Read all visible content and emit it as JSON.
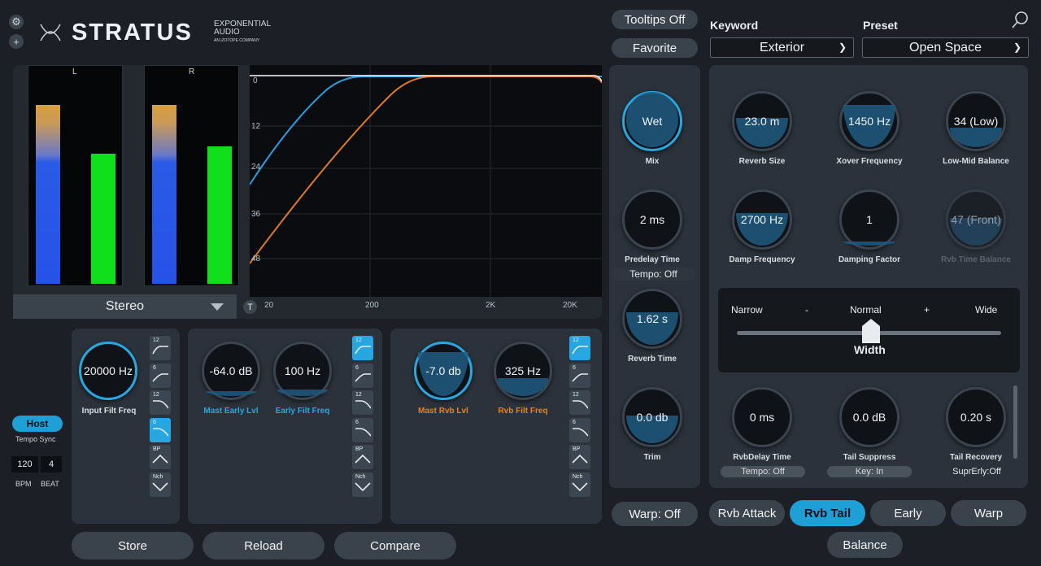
{
  "header": {
    "brand": "STRATUS",
    "maker_line1": "EXPONENTIAL",
    "maker_line2": "AUDIO",
    "maker_line3": "AN iZOTOPE COMPANY",
    "tooltips": "Tooltips Off",
    "favorite": "Favorite",
    "keyword_label": "Keyword",
    "keyword_value": "Exterior",
    "preset_label": "Preset",
    "preset_value": "Open Space"
  },
  "meters": {
    "left_label": "L",
    "right_label": "R",
    "mode": "Stereo"
  },
  "graph": {
    "y_ticks": [
      "0",
      "12",
      "24",
      "36",
      "48"
    ],
    "x_ticks": [
      "20",
      "200",
      "2K",
      "20K"
    ],
    "t_button": "T"
  },
  "filters": {
    "input_filt": {
      "value": "20000 Hz",
      "label": "Input Filt Freq"
    },
    "mast_early": {
      "value": "-64.0 dB",
      "label": "Mast Early Lvl"
    },
    "early_filt": {
      "value": "100 Hz",
      "label": "Early Filt Freq"
    },
    "mast_rvb": {
      "value": "-7.0 db",
      "label": "Mast Rvb Lvl"
    },
    "rvb_filt": {
      "value": "325 Hz",
      "label": "Rvb Filt Freq"
    },
    "types": [
      "12",
      "6",
      "12",
      "6",
      "BP",
      "Nch"
    ]
  },
  "tempo": {
    "host": "Host",
    "sync_label": "Tempo Sync",
    "bpm_value": "120",
    "beat_value": "4",
    "bpm_label": "BPM",
    "beat_label": "BEAT"
  },
  "bottom_buttons": {
    "store": "Store",
    "reload": "Reload",
    "compare": "Compare"
  },
  "center": {
    "mix": {
      "value": "Wet",
      "label": "Mix"
    },
    "predelay": {
      "value": "2 ms",
      "label": "Predelay Time"
    },
    "predelay_tempo": "Tempo: Off",
    "reverb_time": {
      "value": "1.62 s",
      "label": "Reverb Time"
    },
    "trim": {
      "value": "0.0 db",
      "label": "Trim"
    },
    "warp": "Warp: Off"
  },
  "right": {
    "reverb_size": {
      "value": "23.0 m",
      "label": "Reverb Size"
    },
    "xover": {
      "value": "1450 Hz",
      "label": "Xover Frequency"
    },
    "low_mid": {
      "value": "34 (Low)",
      "label": "Low-Mid Balance"
    },
    "damp_freq": {
      "value": "2700 Hz",
      "label": "Damp Frequency"
    },
    "damp_factor": {
      "value": "1",
      "label": "Damping Factor"
    },
    "rvb_time_bal": {
      "value": "47 (Front)",
      "label": "Rvb Time Balance"
    },
    "width": {
      "narrow": "Narrow",
      "minus": "-",
      "normal": "Normal",
      "plus": "+",
      "wide": "Wide",
      "label": "Width"
    },
    "rvb_delay": {
      "value": "0 ms",
      "label": "RvbDelay Time",
      "sub": "Tempo: Off"
    },
    "tail_suppress": {
      "value": "0.0 dB",
      "label": "Tail Suppress",
      "sub": "Key: In"
    },
    "tail_recovery": {
      "value": "0.20 s",
      "label": "Tail Recovery",
      "sub": "SuprErly:Off"
    }
  },
  "tabs": {
    "rvb_attack": "Rvb Attack",
    "rvb_tail": "Rvb Tail",
    "early": "Early",
    "warp": "Warp",
    "balance": "Balance"
  }
}
